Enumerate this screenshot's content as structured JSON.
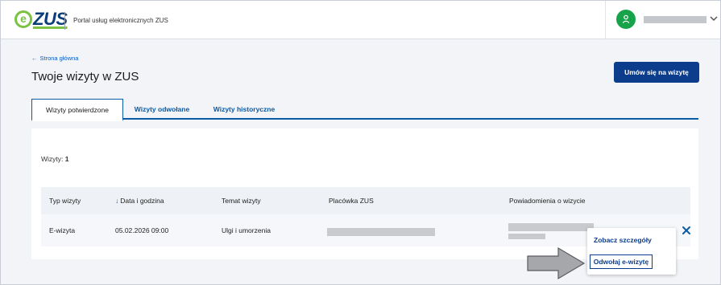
{
  "header": {
    "logo_e": "e",
    "logo_zus": "ZUS",
    "portal_title": "Portal usług elektronicznych ZUS",
    "user_initial_icon": "user-icon"
  },
  "page": {
    "back_link": "Strona główna",
    "title": "Twoje wizyty w ZUS",
    "primary_button": "Umów się na wizytę"
  },
  "tabs": [
    {
      "label": "Wizyty potwierdzone",
      "active": true
    },
    {
      "label": "Wizyty odwołane",
      "active": false
    },
    {
      "label": "Wizyty historyczne",
      "active": false
    }
  ],
  "table": {
    "count_label": "Wizyty:",
    "count_value": "1",
    "columns": [
      "Typ wizyty",
      "Data i godzina",
      "Temat wizyty",
      "Placówka ZUS",
      "Powiadomienia o wizycie"
    ],
    "rows": [
      {
        "type": "E-wizyta",
        "datetime": "05.02.2026 09:00",
        "topic": "Ulgi i umorzenia"
      }
    ]
  },
  "menu": {
    "details": "Zobacz szczegóły",
    "cancel": "Odwołaj e-wizytę"
  },
  "colors": {
    "brand_navy": "#0b3d8c",
    "brand_green": "#7cc242",
    "avatar_green": "#17a34a"
  }
}
